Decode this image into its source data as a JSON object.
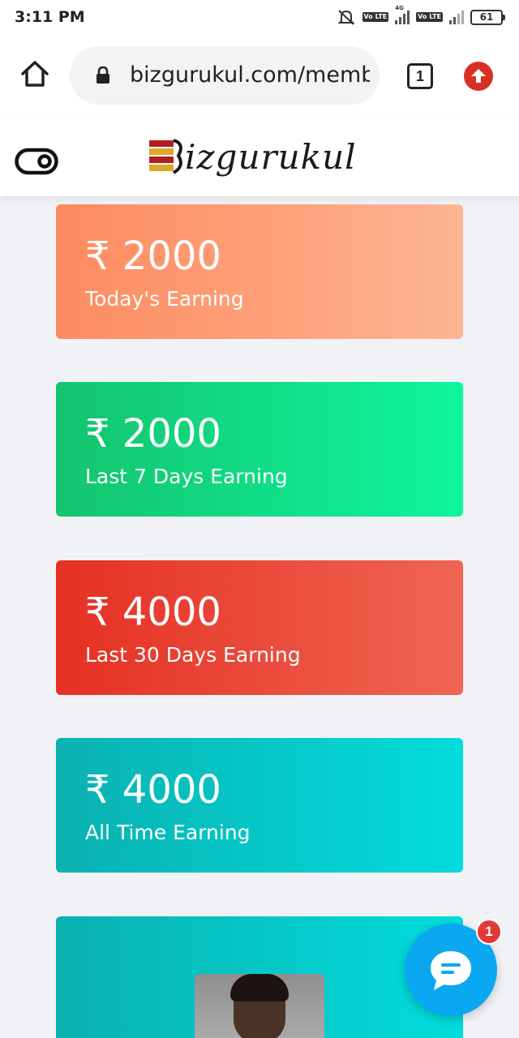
{
  "status_bar": {
    "time": "3:11 PM",
    "network": "4G",
    "volte_label": "Vo LTE",
    "battery": "61"
  },
  "browser": {
    "url": "bizgurukul.com/memb",
    "tab_count": "1"
  },
  "site": {
    "logo_text": "izgurukul"
  },
  "cards": [
    {
      "amount": "₹ 2000",
      "label": "Today's Earning",
      "color_start": "#fd8a5e",
      "color_end": "#fdb594"
    },
    {
      "amount": "₹ 2000",
      "label": "Last 7 Days Earning",
      "color_start": "#14c46d",
      "color_end": "#0df59e"
    },
    {
      "amount": "₹ 4000",
      "label": "Last 30 Days Earning",
      "color_start": "#e53023",
      "color_end": "#f06553"
    },
    {
      "amount": "₹ 4000",
      "label": "All Time Earning",
      "color_start": "#0ab1b1",
      "color_end": "#02dcdc"
    }
  ],
  "chat": {
    "badge_count": "1",
    "icon": "chat-bubble-icon",
    "color": "#0aa8f0"
  }
}
